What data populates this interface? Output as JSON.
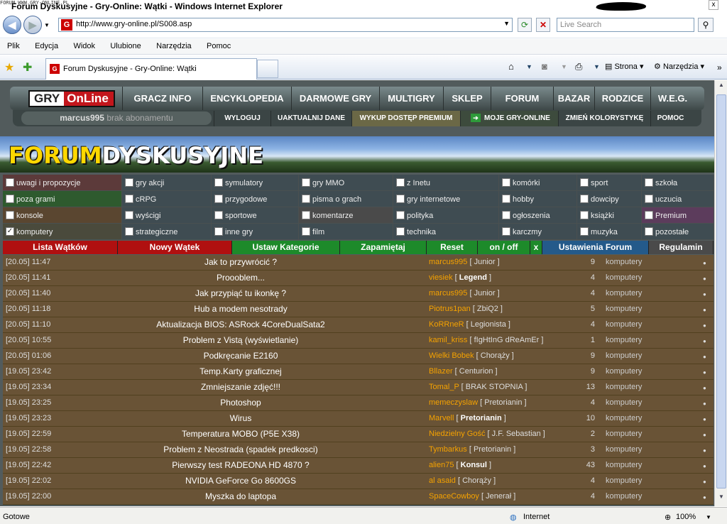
{
  "window": {
    "site_tag": "FORUM WWW.GRY-ONLINE.PL",
    "title": "Forum Dyskusyjne - Gry-Online: Wątki - Windows Internet Explorer",
    "close_label": "x"
  },
  "address": {
    "url": "http://www.gry-online.pl/S008.asp",
    "refresh_icon": "refresh-icon",
    "stop_label": "✕",
    "search_placeholder": "Live Search",
    "search_icon": "magnifier-icon"
  },
  "menu": [
    "Plik",
    "Edycja",
    "Widok",
    "Ulubione",
    "Narzędzia",
    "Pomoc"
  ],
  "tab": {
    "label": "Forum Dyskusyjne - Gry-Online: Wątki",
    "tools": {
      "page": "Strona",
      "tools": "Narzędzia"
    }
  },
  "site": {
    "logo_gry": "GRY",
    "logo_online": "OnLine",
    "nav": [
      "GRACZ INFO",
      "ENCYKLOPEDIA",
      "DARMOWE GRY",
      "MULTIGRY",
      "SKLEP",
      "FORUM",
      "BAZAR",
      "RODZICE",
      "W.E.G."
    ],
    "user": "marcus995",
    "user_status": "brak abonamentu",
    "subnav": [
      "WYLOGUJ",
      "UAKTUALNIJ DANE",
      "WYKUP DOSTĘP PREMIUM",
      "MOJE GRY-ONLINE",
      "ZMIEŃ KOLORYSTYKĘ",
      "POMOC"
    ],
    "banner_forum": "FORUM",
    "banner_dyskusyjne": "DYSKUSYJNE"
  },
  "categories": [
    {
      "label": "uwagi i propozycje",
      "checked": false
    },
    {
      "label": "gry akcji",
      "checked": false
    },
    {
      "label": "symulatory",
      "checked": false
    },
    {
      "label": "gry MMO",
      "checked": false
    },
    {
      "label": "z Inetu",
      "checked": false
    },
    {
      "label": "komórki",
      "checked": false
    },
    {
      "label": "sport",
      "checked": false
    },
    {
      "label": "szkoła",
      "checked": false
    },
    {
      "label": "poza grami",
      "checked": false
    },
    {
      "label": "cRPG",
      "checked": false
    },
    {
      "label": "przygodowe",
      "checked": false
    },
    {
      "label": "pisma o grach",
      "checked": false
    },
    {
      "label": "gry internetowe",
      "checked": false
    },
    {
      "label": "hobby",
      "checked": false
    },
    {
      "label": "dowcipy",
      "checked": false
    },
    {
      "label": "uczucia",
      "checked": false
    },
    {
      "label": "konsole",
      "checked": false
    },
    {
      "label": "wyścigi",
      "checked": false
    },
    {
      "label": "sportowe",
      "checked": false
    },
    {
      "label": "komentarze",
      "checked": false
    },
    {
      "label": "polityka",
      "checked": false
    },
    {
      "label": "ogłoszenia",
      "checked": false
    },
    {
      "label": "książki",
      "checked": false
    },
    {
      "label": "Premium",
      "checked": false
    },
    {
      "label": "komputery",
      "checked": true
    },
    {
      "label": "strategiczne",
      "checked": false
    },
    {
      "label": "inne gry",
      "checked": false
    },
    {
      "label": "film",
      "checked": false
    },
    {
      "label": "technika",
      "checked": false
    },
    {
      "label": "karczmy",
      "checked": false
    },
    {
      "label": "muzyka",
      "checked": false
    },
    {
      "label": "pozostałe",
      "checked": false
    }
  ],
  "actions": [
    "Lista Wątków",
    "Nowy Wątek",
    "Ustaw Kategorie",
    "Zapamiętaj",
    "Reset",
    "on / off",
    "x",
    "Ustawienia Forum",
    "Regulamin"
  ],
  "threads": [
    {
      "date": "[20.05] 11:47",
      "title": "Jak to przywrócić ?",
      "author": "marcus995",
      "rank": "Junior",
      "rank_bold": false,
      "count": "9",
      "category": "komputery"
    },
    {
      "date": "[20.05] 11:41",
      "title": "Proooblem...",
      "author": "viesiek",
      "rank": "Legend",
      "rank_bold": true,
      "count": "4",
      "category": "komputery"
    },
    {
      "date": "[20.05] 11:40",
      "title": "Jak przypiąć tu ikonkę ?",
      "author": "marcus995",
      "rank": "Junior",
      "rank_bold": false,
      "count": "4",
      "category": "komputery"
    },
    {
      "date": "[20.05] 11:18",
      "title": "Hub a modem nesotrady",
      "author": "Piotrus1pan",
      "rank": "ZbiQ2",
      "rank_bold": false,
      "count": "5",
      "category": "komputery"
    },
    {
      "date": "[20.05] 11:10",
      "title": "Aktualizacja BIOS: ASRock 4CoreDualSata2",
      "author": "KoRRneR",
      "rank": "Legionista",
      "rank_bold": false,
      "count": "4",
      "category": "komputery"
    },
    {
      "date": "[20.05] 10:55",
      "title": "Problem z Vistą (wyświetlanie)",
      "author": "kamil_kriss",
      "rank": "fIgHtInG dReAmEr",
      "rank_bold": false,
      "count": "1",
      "category": "komputery"
    },
    {
      "date": "[20.05] 01:06",
      "title": "Podkręcanie E2160",
      "author": "Wielki Bobek",
      "rank": "Chorąży",
      "rank_bold": false,
      "count": "9",
      "category": "komputery"
    },
    {
      "date": "[19.05] 23:42",
      "title": "Temp.Karty graficznej",
      "author": "Bllazer",
      "rank": "Centurion",
      "rank_bold": false,
      "count": "9",
      "category": "komputery"
    },
    {
      "date": "[19.05] 23:34",
      "title": "Zmniejszanie zdjęć!!!",
      "author": "Tomal_P",
      "rank": "BRAK STOPNIA",
      "rank_bold": false,
      "count": "13",
      "category": "komputery"
    },
    {
      "date": "[19.05] 23:25",
      "title": "Photoshop",
      "author": "memeczyslaw",
      "rank": "Pretorianin",
      "rank_bold": false,
      "count": "4",
      "category": "komputery"
    },
    {
      "date": "[19.05] 23:23",
      "title": "Wirus",
      "author": "Marvell",
      "rank": "Pretorianin",
      "rank_bold": true,
      "count": "10",
      "category": "komputery"
    },
    {
      "date": "[19.05] 22:59",
      "title": "Temperatura MOBO (P5E X38)",
      "author": "Niedzielny Gość",
      "rank": "J.F. Sebastian",
      "rank_bold": false,
      "count": "2",
      "category": "komputery"
    },
    {
      "date": "[19.05] 22:58",
      "title": "Problem z Neostrada (spadek predkosci)",
      "author": "Tymbarkus",
      "rank": "Pretorianin",
      "rank_bold": false,
      "count": "3",
      "category": "komputery"
    },
    {
      "date": "[19.05] 22:42",
      "title": "Pierwszy test RADEONA HD 4870 ?",
      "author": "alien75",
      "rank": "Konsul",
      "rank_bold": true,
      "count": "43",
      "category": "komputery"
    },
    {
      "date": "[19.05] 22:02",
      "title": "NVIDIA GeForce Go 8600GS",
      "author": "al asaid",
      "rank": "Chorąży",
      "rank_bold": false,
      "count": "4",
      "category": "komputery"
    },
    {
      "date": "[19.05] 22:00",
      "title": "Myszka do laptopa",
      "author": "SpaceCowboy",
      "rank": "Jenerał",
      "rank_bold": false,
      "count": "4",
      "category": "komputery"
    }
  ],
  "status": {
    "left": "Gotowe",
    "zone": "Internet",
    "zoom": "100%"
  }
}
